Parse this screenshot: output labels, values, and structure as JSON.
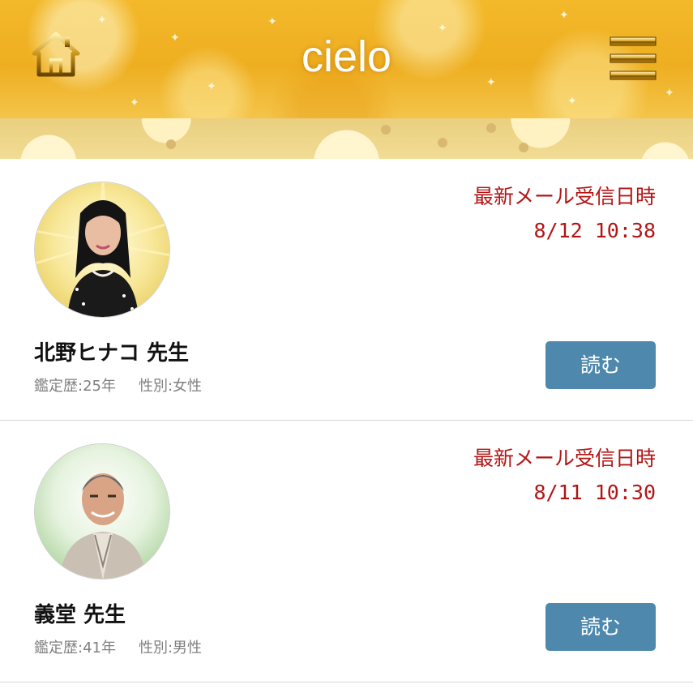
{
  "header": {
    "title": "cielo",
    "home_icon": "home-icon",
    "menu_icon": "hamburger-menu-icon"
  },
  "colors": {
    "header_gold": "#eeae20",
    "date_red": "#b31515",
    "button_blue": "#4e89ad"
  },
  "messages": [
    {
      "mail_label": "最新メール受信日時",
      "mail_date": "8/12 10:38",
      "name": "北野ヒナコ 先生",
      "experience": "鑑定歴:25年",
      "gender": "性別:女性",
      "read_label": "読む"
    },
    {
      "mail_label": "最新メール受信日時",
      "mail_date": "8/11 10:30",
      "name": "義堂 先生",
      "experience": "鑑定歴:41年",
      "gender": "性別:男性",
      "read_label": "読む"
    }
  ]
}
